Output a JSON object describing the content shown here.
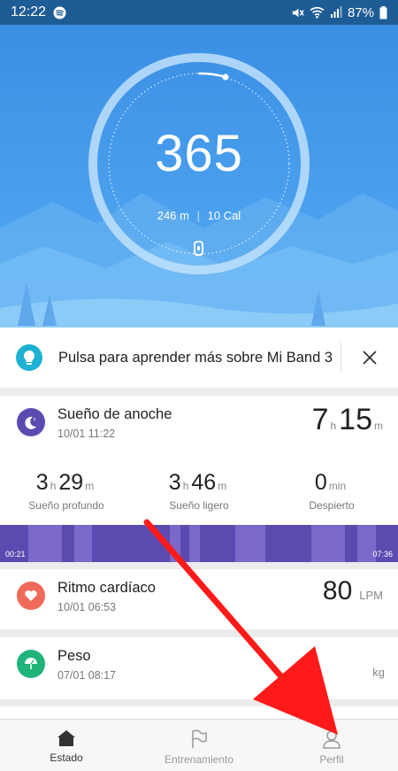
{
  "status_bar": {
    "time": "12:22",
    "battery": "87%"
  },
  "hero": {
    "steps": "365",
    "distance": "246",
    "distance_unit": "m",
    "calories": "10",
    "calories_unit": "Cal"
  },
  "tip": {
    "text": "Pulsa para aprender más sobre Mi Band 3",
    "close_icon": "×"
  },
  "sleep": {
    "title": "Sueño de anoche",
    "date": "10/01 11:22",
    "total_hours": "7",
    "total_minutes": "15",
    "unit_h": "h",
    "unit_m": "m",
    "unit_min": "min",
    "deep": {
      "h": "3",
      "m": "29",
      "label": "Sueño profundo"
    },
    "light": {
      "h": "3",
      "m": "46",
      "label": "Sueño ligero"
    },
    "awake": {
      "m": "0",
      "label": "Despierto"
    },
    "start": "00:21",
    "end": "07:36"
  },
  "heart": {
    "title": "Ritmo cardíaco",
    "date": "10/01 06:53",
    "value": "80",
    "unit": "LPM"
  },
  "weight": {
    "title": "Peso",
    "date": "07/01 08:17",
    "unit": "kg"
  },
  "nav": {
    "items": [
      {
        "label": "Estado",
        "icon": "home-icon"
      },
      {
        "label": "Entrenamiento",
        "icon": "flag-icon"
      },
      {
        "label": "Perfil",
        "icon": "person-icon"
      }
    ]
  },
  "colors": {
    "accent": "#3b8fe4",
    "sleep": "#5b4bb0",
    "heart": "#f06a5a",
    "weight": "#20b37a",
    "tip": "#1fb1d4",
    "arrow": "#ff1a1a"
  }
}
